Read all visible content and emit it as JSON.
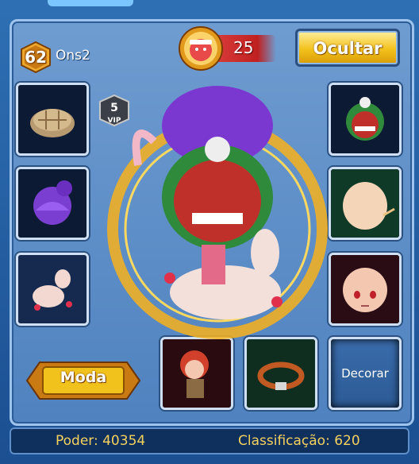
{
  "header": {
    "level": "62",
    "player_name": "Ons2",
    "vip_count": "25",
    "hide_button_label": "Ocultar",
    "vip_level": "5",
    "vip_level_tag": "VIP"
  },
  "slots": {
    "left": [
      {
        "name": "helmet-slot",
        "icon": "turtle-shell-helmet-icon"
      },
      {
        "name": "hair-slot",
        "icon": "purple-hair-icon"
      },
      {
        "name": "mount-slot",
        "icon": "llama-mount-icon"
      }
    ],
    "right": [
      {
        "name": "mask-slot",
        "icon": "tribal-mask-icon"
      },
      {
        "name": "face-slot",
        "icon": "face-icon"
      },
      {
        "name": "eyes-slot",
        "icon": "face-eyes-icon"
      }
    ],
    "bottom": [
      {
        "name": "pet-slot",
        "icon": "red-hair-character-icon"
      },
      {
        "name": "belt-slot",
        "icon": "belt-icon"
      }
    ],
    "decorate_label": "Decorar"
  },
  "fashion_button_label": "Moda",
  "stats": {
    "power": "Poder: 40354",
    "rank": "Classificação: 620"
  },
  "colors": {
    "panel": "#5a8bc6",
    "gold_button": "#f2c21c",
    "stat_text": "#f6d25e",
    "frame": "#1b4f91"
  }
}
